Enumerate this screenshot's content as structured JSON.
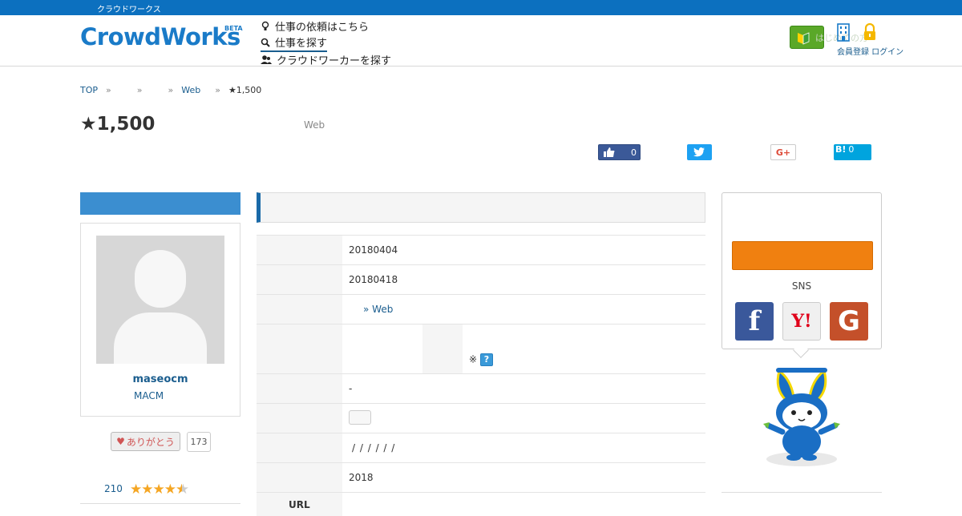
{
  "topbar": {
    "text": "クラウドワークス"
  },
  "header": {
    "logo": "CrowdWorks",
    "logo_badge": "BETA",
    "nav": [
      {
        "label": "仕事の依頼はこちら",
        "icon": "bulb-icon"
      },
      {
        "label": "仕事を探す",
        "icon": "search-icon"
      },
      {
        "label": "クラウドワーカーを探す",
        "icon": "users-icon"
      }
    ],
    "beginner_label": "はじめての方",
    "header_links": "会員登録 ログイン"
  },
  "breadcrumb": [
    "TOP",
    "",
    "",
    "Web",
    "★1,500"
  ],
  "job": {
    "price_title": "★1,500",
    "category": "Web"
  },
  "share": {
    "facebook_count": "0",
    "hatena_label": "B!",
    "hatena_count": "0",
    "gplus_label": "G+"
  },
  "profile": {
    "username": "maseocm",
    "usertag": "MACM",
    "thanks_label": "ありがとう",
    "thanks_count": "173",
    "rating_count": "210",
    "rating_stars": 4.5
  },
  "detail_rows": [
    {
      "value": "20180404"
    },
    {
      "value": "20180418"
    },
    {
      "value": "» Web"
    },
    {
      "value": "※"
    },
    {
      "value": "-"
    },
    {
      "value": ""
    },
    {
      "value": "/ / / / / /"
    },
    {
      "value": "2018"
    },
    {
      "label": "URL",
      "value": ""
    }
  ],
  "sidebar": {
    "sns_label": "SNS",
    "sns": [
      {
        "icon": "facebook-icon",
        "glyph": "f"
      },
      {
        "icon": "yahoo-icon",
        "glyph": "Y!"
      },
      {
        "icon": "google-icon",
        "glyph": "G"
      }
    ]
  },
  "colors": {
    "brand": "#0c70bf",
    "apply": "#f08010",
    "link": "#1a5d8e"
  }
}
